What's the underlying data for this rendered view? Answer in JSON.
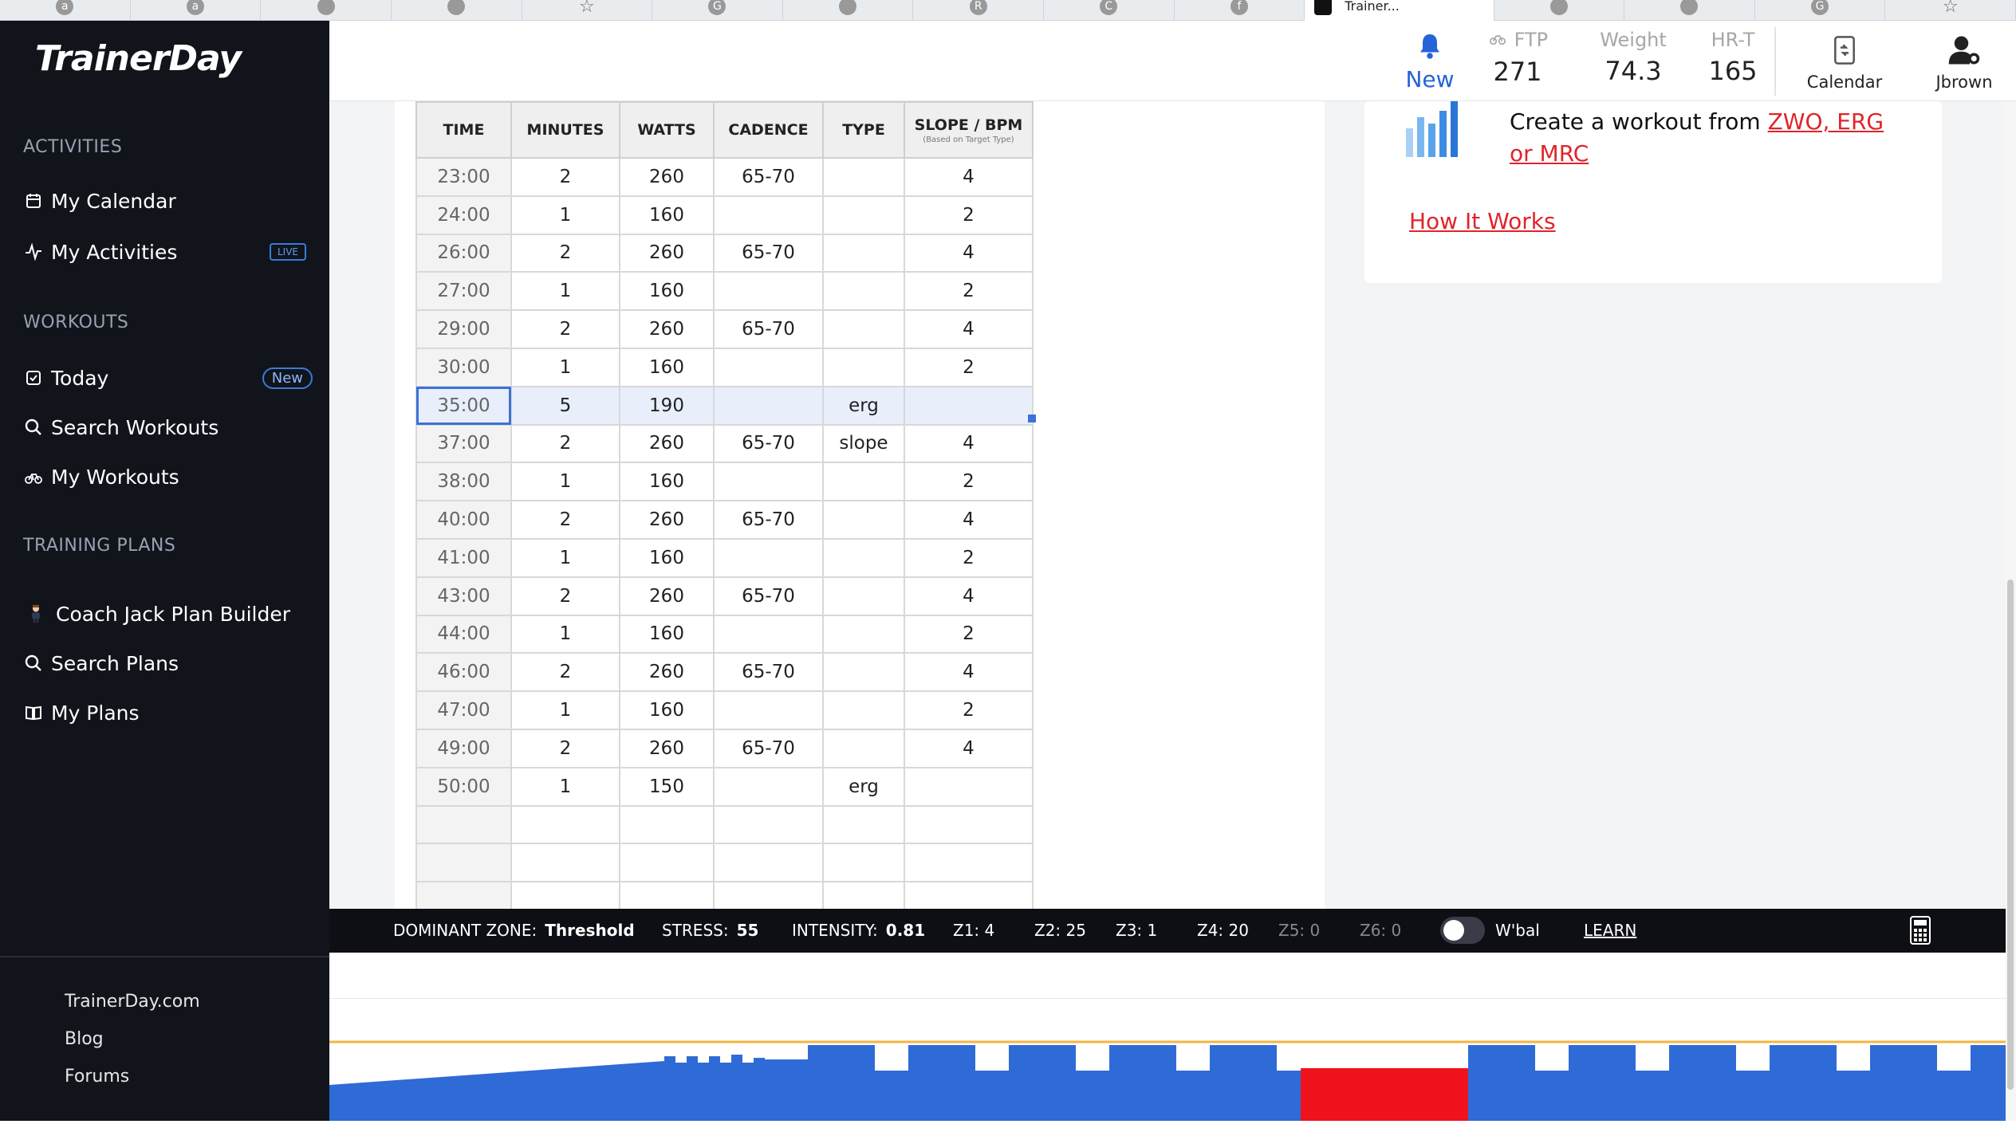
{
  "browser": {
    "tabs": [
      {
        "icon": "amazon-icon",
        "glyph": "a"
      },
      {
        "icon": "amazon-icon",
        "glyph": "a"
      },
      {
        "icon": "google-apps-icon",
        "glyph": ""
      },
      {
        "icon": "google-slides-icon",
        "glyph": ""
      },
      {
        "icon": "star-icon",
        "glyph": "☆"
      },
      {
        "icon": "google-icon",
        "glyph": "G"
      },
      {
        "icon": "flag-icon",
        "glyph": ""
      },
      {
        "icon": "r-icon",
        "glyph": "R"
      },
      {
        "icon": "c-icon",
        "glyph": "C"
      },
      {
        "icon": "facebook-icon",
        "glyph": "f"
      }
    ],
    "active_tab": {
      "title": "Trainer..."
    },
    "tabs_after": [
      {
        "icon": "trainerday-icon",
        "glyph": ""
      },
      {
        "icon": "maps-icon",
        "glyph": ""
      },
      {
        "icon": "g-icon",
        "glyph": "G"
      },
      {
        "icon": "star-icon",
        "glyph": "☆"
      }
    ]
  },
  "sidebar": {
    "logo": "TrainerDay",
    "activities_title": "ACTIVITIES",
    "my_calendar": "My Calendar",
    "my_activities": "My Activities",
    "live_badge": "LIVE",
    "workouts_title": "WORKOUTS",
    "today": "Today",
    "new_badge": "New",
    "search_workouts": "Search Workouts",
    "my_workouts": "My Workouts",
    "training_plans_title": "TRAINING PLANS",
    "coach_jack": "Coach Jack Plan Builder",
    "search_plans": "Search Plans",
    "my_plans": "My Plans",
    "footer": {
      "site": "TrainerDay.com",
      "blog": "Blog",
      "forums": "Forums"
    }
  },
  "header": {
    "notifications_label": "New",
    "ftp_label": "FTP",
    "ftp_value": "271",
    "weight_label": "Weight",
    "weight_value": "74.3",
    "hrt_label": "HR-T",
    "hrt_value": "165",
    "calendar_label": "Calendar",
    "user_label": "Jbrown"
  },
  "right_panel": {
    "create_text": "Create a workout from ",
    "create_link": "ZWO, ERG or MRC",
    "how_it_works": "How It Works"
  },
  "table": {
    "columns": {
      "time": "TIME",
      "minutes": "MINUTES",
      "watts": "WATTS",
      "cadence": "CADENCE",
      "type": "TYPE",
      "slope": "SLOPE / BPM",
      "slope_sub": "(Based on Target Type)"
    },
    "rows": [
      {
        "time": "23:00",
        "minutes": "2",
        "watts": "260",
        "cadence": "65-70",
        "type": "",
        "slope": "4"
      },
      {
        "time": "24:00",
        "minutes": "1",
        "watts": "160",
        "cadence": "",
        "type": "",
        "slope": "2"
      },
      {
        "time": "26:00",
        "minutes": "2",
        "watts": "260",
        "cadence": "65-70",
        "type": "",
        "slope": "4"
      },
      {
        "time": "27:00",
        "minutes": "1",
        "watts": "160",
        "cadence": "",
        "type": "",
        "slope": "2"
      },
      {
        "time": "29:00",
        "minutes": "2",
        "watts": "260",
        "cadence": "65-70",
        "type": "",
        "slope": "4"
      },
      {
        "time": "30:00",
        "minutes": "1",
        "watts": "160",
        "cadence": "",
        "type": "",
        "slope": "2"
      },
      {
        "time": "35:00",
        "minutes": "5",
        "watts": "190",
        "cadence": "",
        "type": "erg",
        "slope": "",
        "selected": true
      },
      {
        "time": "37:00",
        "minutes": "2",
        "watts": "260",
        "cadence": "65-70",
        "type": "slope",
        "slope": "4"
      },
      {
        "time": "38:00",
        "minutes": "1",
        "watts": "160",
        "cadence": "",
        "type": "",
        "slope": "2"
      },
      {
        "time": "40:00",
        "minutes": "2",
        "watts": "260",
        "cadence": "65-70",
        "type": "",
        "slope": "4"
      },
      {
        "time": "41:00",
        "minutes": "1",
        "watts": "160",
        "cadence": "",
        "type": "",
        "slope": "2"
      },
      {
        "time": "43:00",
        "minutes": "2",
        "watts": "260",
        "cadence": "65-70",
        "type": "",
        "slope": "4"
      },
      {
        "time": "44:00",
        "minutes": "1",
        "watts": "160",
        "cadence": "",
        "type": "",
        "slope": "2"
      },
      {
        "time": "46:00",
        "minutes": "2",
        "watts": "260",
        "cadence": "65-70",
        "type": "",
        "slope": "4"
      },
      {
        "time": "47:00",
        "minutes": "1",
        "watts": "160",
        "cadence": "",
        "type": "",
        "slope": "2"
      },
      {
        "time": "49:00",
        "minutes": "2",
        "watts": "260",
        "cadence": "65-70",
        "type": "",
        "slope": "4"
      },
      {
        "time": "50:00",
        "minutes": "1",
        "watts": "150",
        "cadence": "",
        "type": "erg",
        "slope": ""
      },
      {
        "time": "",
        "minutes": "",
        "watts": "",
        "cadence": "",
        "type": "",
        "slope": ""
      },
      {
        "time": "",
        "minutes": "",
        "watts": "",
        "cadence": "",
        "type": "",
        "slope": ""
      },
      {
        "time": "",
        "minutes": "",
        "watts": "",
        "cadence": "",
        "type": "",
        "slope": ""
      }
    ]
  },
  "stats": {
    "dominant_zone_label": "DOMINANT ZONE:",
    "dominant_zone_value": "Threshold",
    "stress_label": "STRESS:",
    "stress_value": "55",
    "intensity_label": "INTENSITY:",
    "intensity_value": "0.81",
    "z1": "Z1: 4",
    "z2": "Z2: 25",
    "z3": "Z3: 1",
    "z4": "Z4: 20",
    "z5": "Z5: 0",
    "z6": "Z6: 0",
    "wbal_label": "W'bal",
    "wbal_enabled": false,
    "learn": "LEARN"
  },
  "colors": {
    "accent_blue": "#2f6bd6",
    "highlight_red": "#f0131e",
    "ftp_line": "#f4b63f",
    "sidebar_bg": "#12141c"
  }
}
